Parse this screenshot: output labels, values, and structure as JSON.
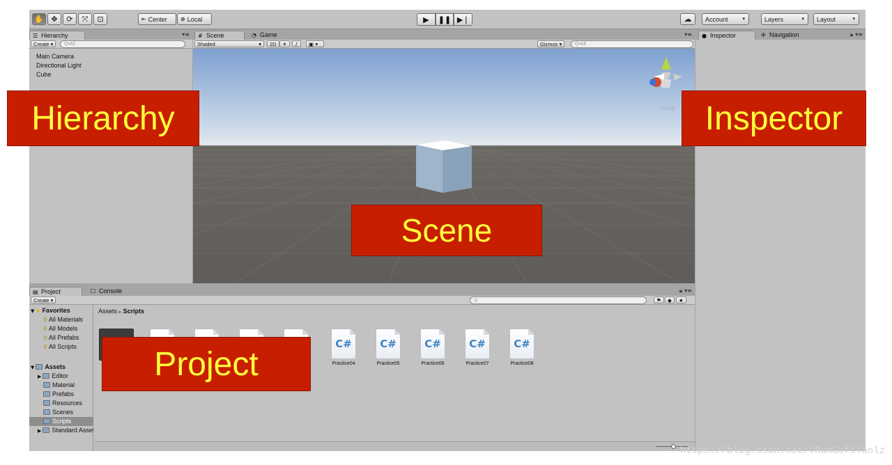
{
  "toolbar": {
    "tools": [
      "hand-icon",
      "move-icon",
      "rotate-icon",
      "scale-icon",
      "rect-icon"
    ],
    "pivot_label": "Center",
    "space_label": "Local",
    "cloud_icon": "cloud-icon",
    "account_label": "Account",
    "layers_label": "Layers",
    "layout_label": "Layout"
  },
  "hierarchy": {
    "tab_label": "Hierarchy",
    "create_label": "Create",
    "search_placeholder": "Q•All",
    "items": [
      "Main Camera",
      "Directional Light",
      "Cube"
    ]
  },
  "scene": {
    "tabs": [
      {
        "label": "Scene",
        "active": true
      },
      {
        "label": "Game",
        "active": false
      }
    ],
    "shading_label": "Shaded",
    "mode_2d": "2D",
    "gizmos_label": "Gizmos",
    "search_placeholder": "Q•All",
    "persp_label": "Persp"
  },
  "inspector": {
    "tabs": [
      {
        "label": "Inspector",
        "active": true
      },
      {
        "label": "Navigation",
        "active": false
      }
    ]
  },
  "project": {
    "tabs": [
      {
        "label": "Project",
        "active": true
      },
      {
        "label": "Console",
        "active": false
      }
    ],
    "create_label": "Create",
    "favorites_label": "Favorites",
    "favorites": [
      "All Materials",
      "All Models",
      "All Prefabs",
      "All Scripts"
    ],
    "assets_label": "Assets",
    "folders": [
      "Editor",
      "Material",
      "Prefabs",
      "Resources",
      "Scenes",
      "Scripts",
      "Standard Assets"
    ],
    "selected_folder": "Scripts",
    "breadcrumb": {
      "root": "Assets",
      "separator": "▸",
      "current": "Scripts"
    },
    "scripts": [
      "Practice04",
      "Practice05",
      "Practice06",
      "Practice07",
      "Practice08"
    ]
  },
  "callouts": {
    "hierarchy": "Hierarchy",
    "inspector": "Inspector",
    "scene": "Scene",
    "project": "Project"
  },
  "watermark": "https://blog.csdn.net/VRunSoftYanlz",
  "colors": {
    "callout_bg": "#c81e00",
    "callout_text": "#ffff3b",
    "panel_bg": "#c2c2c2",
    "selection": "#8e8e8e",
    "cs_icon": "#3d84c6"
  }
}
